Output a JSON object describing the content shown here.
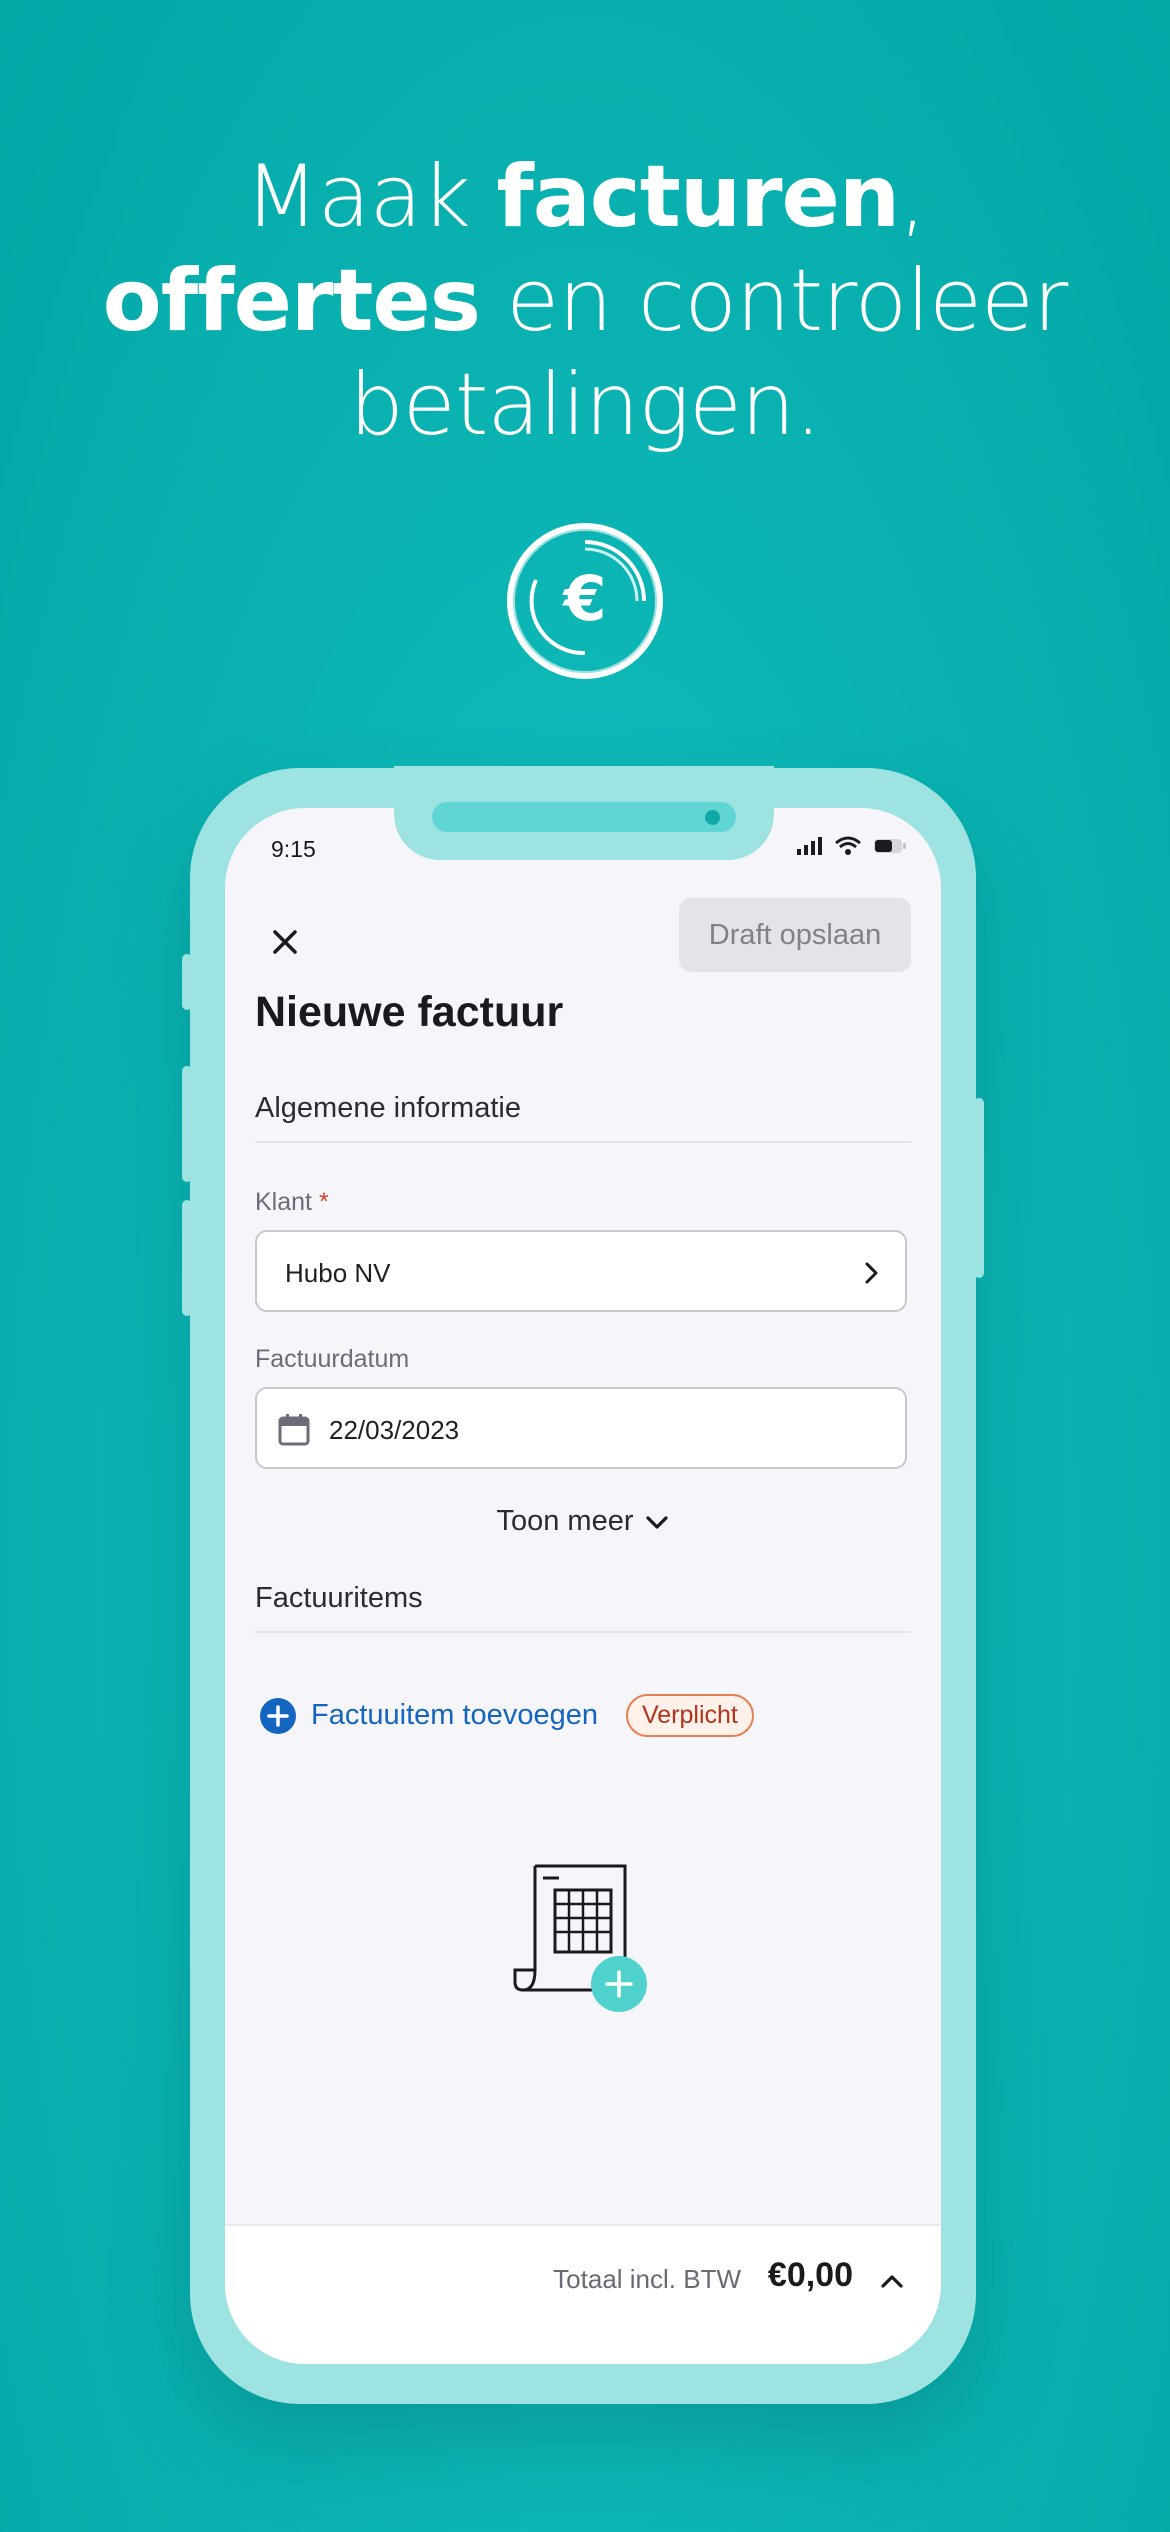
{
  "headline": {
    "line1_pre": "Maak ",
    "line1_bold": "facturen",
    "line1_post": ",",
    "line2_bold": "offertes",
    "line2_post": " en controleer",
    "line3": "betalingen."
  },
  "badge": {
    "symbol": "€",
    "icon": "euro-coin-icon"
  },
  "status_bar": {
    "time": "9:15",
    "icons": [
      "signal-icon",
      "wifi-icon",
      "battery-icon"
    ]
  },
  "toolbar": {
    "close_icon": "close-icon",
    "draft_label": "Draft opslaan"
  },
  "page": {
    "title": "Nieuwe factuur"
  },
  "general": {
    "header": "Algemene informatie",
    "client": {
      "label": "Klant",
      "required_mark": "*",
      "value": "Hubo NV"
    },
    "invoice_date": {
      "label": "Factuurdatum",
      "value": "22/03/2023"
    },
    "show_more": "Toon meer"
  },
  "items": {
    "header": "Factuuritems",
    "add_label": "Factuuitem toevoegen",
    "required_badge": "Verplicht"
  },
  "footer": {
    "total_label": "Totaal incl. BTW",
    "total_value": "€0,00"
  },
  "colors": {
    "background": "#0bb5b4",
    "phone_frame": "#9de3e1",
    "link_blue": "#1465bf",
    "required_orange": "#e6814f",
    "illustration_accent": "#4fd1cd"
  }
}
